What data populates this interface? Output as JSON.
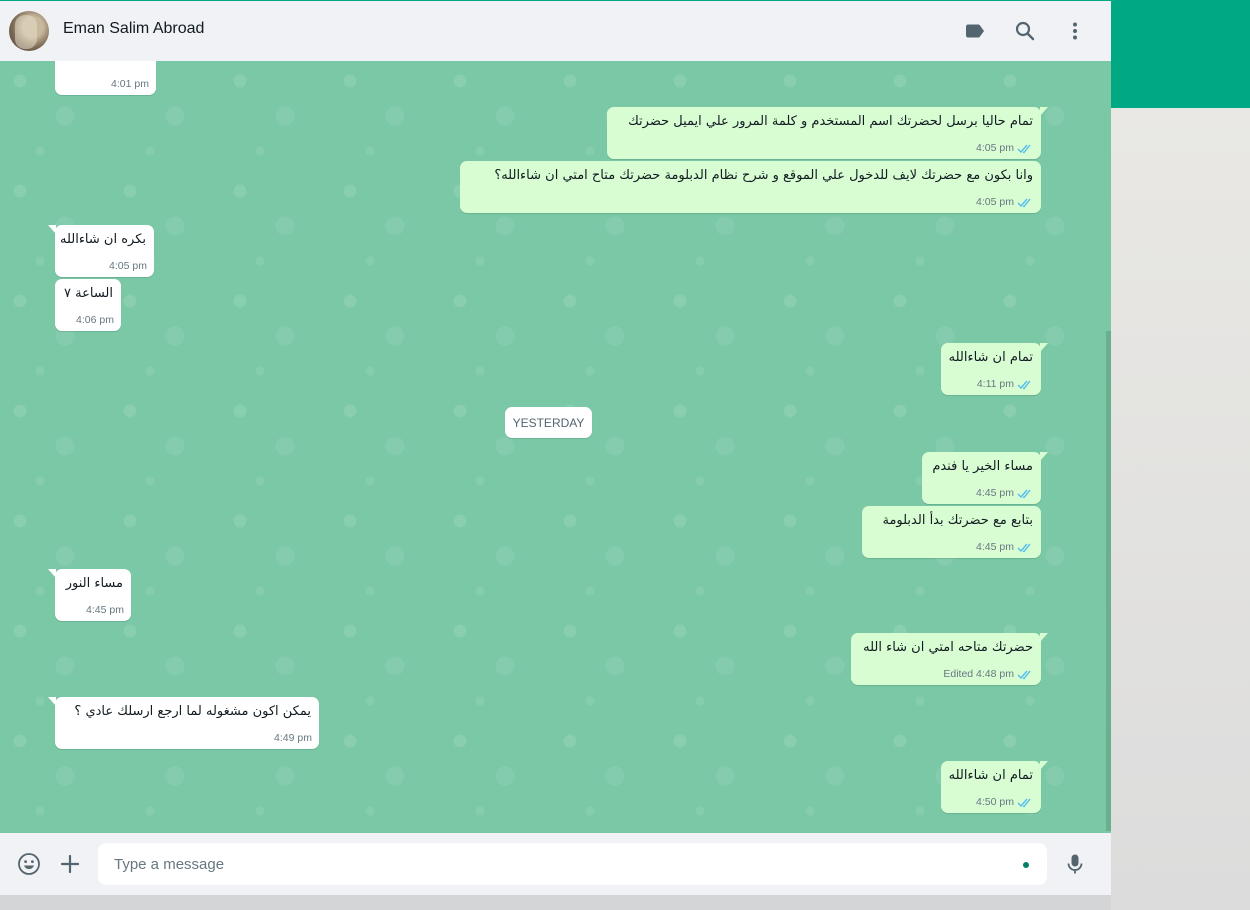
{
  "header": {
    "contact_name": "Eman Salim Abroad"
  },
  "icons": {
    "label": "label-icon",
    "search": "search-icon",
    "menu": "menu-icon",
    "emoji": "emoji-icon",
    "attach": "plus-icon",
    "mic": "mic-icon",
    "ticks": "double-check-icon"
  },
  "colors": {
    "brand": "#00a884",
    "chat_background": "#7ac8a6",
    "outgoing_bubble": "#d9fdd3",
    "incoming_bubble": "#ffffff",
    "read_ticks": "#53bdeb"
  },
  "messages": [
    {
      "dir": "in",
      "text": "",
      "time": "4:01 pm"
    },
    {
      "dir": "out",
      "text": "تمام حاليا برسل لحضرتك اسم المستخدم و كلمة المرور علي ايميل حضرتك",
      "time": "4:05 pm"
    },
    {
      "dir": "out",
      "text": "وانا بكون مع حضرتك لايف للدخول علي الموقع و شرح نظام الدبلومة حضرتك متاح امتي ان شاءالله؟",
      "time": "4:05 pm"
    },
    {
      "dir": "in",
      "text": "بكره ان شاءالله",
      "time": "4:05 pm"
    },
    {
      "dir": "in",
      "text": "الساعة ٧",
      "time": "4:06 pm"
    },
    {
      "dir": "out",
      "text": "تمام ان شاءالله",
      "time": "4:11 pm"
    },
    {
      "dir": "out",
      "text": "مساء الخير يا فندم",
      "time": "4:45 pm"
    },
    {
      "dir": "out",
      "text": "بتابع مع حضرتك بدأ الدبلومة",
      "time": "4:45 pm"
    },
    {
      "dir": "in",
      "text": "مساء النور",
      "time": "4:45 pm"
    },
    {
      "dir": "out",
      "text": "حضرتك متاحه امتي ان شاء الله",
      "time": "Edited 4:48 pm"
    },
    {
      "dir": "in",
      "text": "يمكن اكون مشغوله لما ارجع ارسلك عادي ؟",
      "time": "4:49 pm"
    },
    {
      "dir": "out",
      "text": "تمام ان شاءالله",
      "time": "4:50 pm"
    }
  ],
  "date_separator": "YESTERDAY",
  "composer": {
    "placeholder": "Type a message",
    "value": ""
  }
}
